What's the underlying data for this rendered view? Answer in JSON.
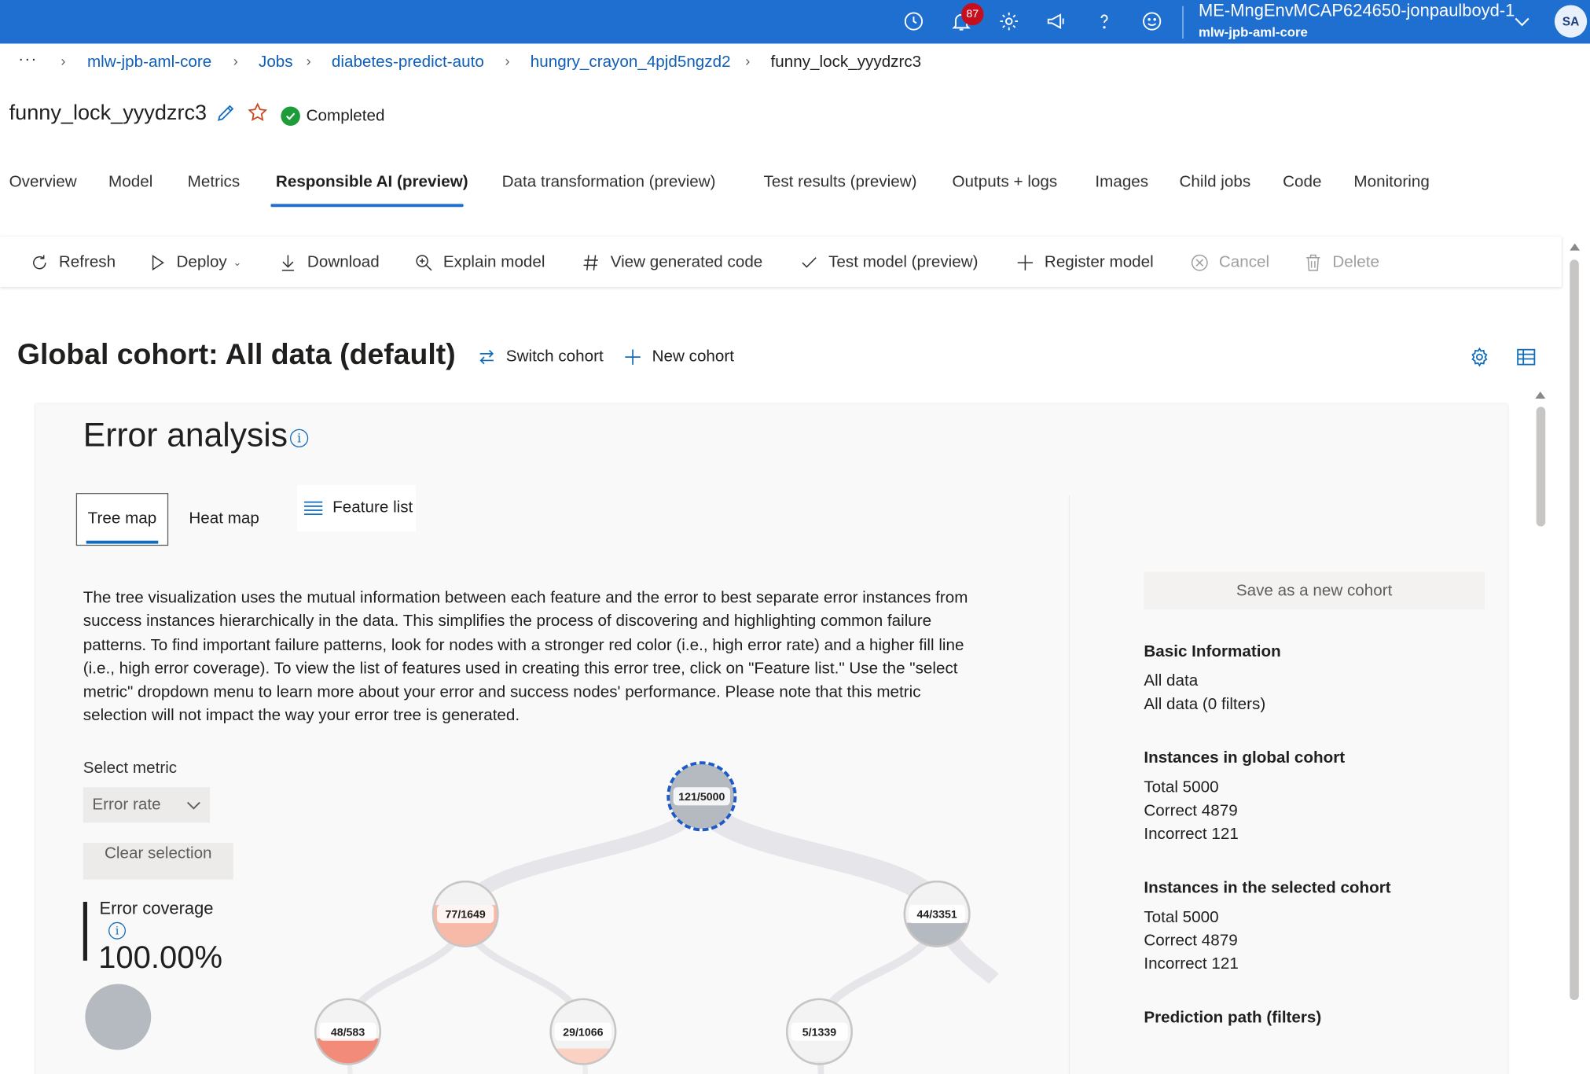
{
  "topbar": {
    "notification_count": "87",
    "account_name": "ME-MngEnvMCAP624650-jonpaulboyd-1",
    "account_sub": "mlw-jpb-aml-core",
    "avatar_initials": "SA",
    "accent": "#1f6fd0",
    "icons": [
      "clock-icon",
      "bell-icon",
      "gear-icon",
      "megaphone-icon",
      "help-icon",
      "smiley-icon"
    ]
  },
  "breadcrumb": {
    "more": "···",
    "items": [
      "mlw-jpb-aml-core",
      "Jobs",
      "diabetes-predict-auto",
      "hungry_crayon_4pjd5ngzd2"
    ],
    "current": "funny_lock_yyydzrc3"
  },
  "job": {
    "title": "funny_lock_yyydzrc3",
    "status": "Completed",
    "status_color": "#1f9c3a"
  },
  "tabs": [
    "Overview",
    "Model",
    "Metrics",
    "Responsible AI (preview)",
    "Data transformation (preview)",
    "Test results (preview)",
    "Outputs + logs",
    "Images",
    "Child jobs",
    "Code",
    "Monitoring"
  ],
  "active_tab": "Responsible AI (preview)",
  "toolbar": {
    "refresh": "Refresh",
    "deploy": "Deploy",
    "download": "Download",
    "explain": "Explain model",
    "view_code": "View generated code",
    "test_model": "Test model (preview)",
    "register": "Register model",
    "cancel": "Cancel",
    "delete": "Delete"
  },
  "cohort": {
    "title": "Global cohort: All data (default)",
    "switch": "Switch cohort",
    "new": "New cohort"
  },
  "error_analysis": {
    "title": "Error analysis",
    "pivots": {
      "tree_map": "Tree map",
      "heat_map": "Heat map"
    },
    "selected_pivot": "Tree map",
    "feature_list": "Feature list",
    "description": "The tree visualization uses the mutual information between each feature and the error to best separate error instances from success instances hierarchically in the data. This simplifies the process of discovering and highlighting common failure patterns. To find important failure patterns, look for nodes with a stronger red color (i.e., high error rate) and a higher fill line (i.e., high error coverage). To view the list of features used in creating this error tree, click on \"Feature list.\" Use the \"select metric\" dropdown menu to learn more about your error and success nodes' performance. Please note that this metric selection will not impact the way your error tree is generated.",
    "select_metric_label": "Select metric",
    "select_metric_value": "Error rate",
    "clear_selection": "Clear selection",
    "error_coverage_label": "Error coverage",
    "error_coverage_value": "100.00%",
    "tree_nodes": [
      {
        "label": "121/5000",
        "errors": 121,
        "total": 5000,
        "selected": true,
        "fill_color": "#b5b9c0"
      },
      {
        "label": "77/1649",
        "errors": 77,
        "total": 1649,
        "fill_color": "#f7b9a8"
      },
      {
        "label": "44/3351",
        "errors": 44,
        "total": 3351,
        "fill_color": "#b5b9c0"
      },
      {
        "label": "48/583",
        "errors": 48,
        "total": 583,
        "fill_color": "#f28b7a"
      },
      {
        "label": "29/1066",
        "errors": 29,
        "total": 1066,
        "fill_color": "#fbd1c3"
      },
      {
        "label": "5/1339",
        "errors": 5,
        "total": 1339,
        "fill_color": "#e8e8e8"
      }
    ]
  },
  "info_panel": {
    "save_cohort": "Save as a new cohort",
    "basic_info": {
      "heading": "Basic Information",
      "line1": "All data",
      "line2": "All data (0 filters)"
    },
    "global": {
      "heading": "Instances in global cohort",
      "total": "Total 5000",
      "correct": "Correct 4879",
      "incorrect": "Incorrect 121"
    },
    "selected": {
      "heading": "Instances in the selected cohort",
      "total": "Total 5000",
      "correct": "Correct 4879",
      "incorrect": "Incorrect 121"
    },
    "prediction_path": {
      "heading": "Prediction path (filters)"
    }
  }
}
